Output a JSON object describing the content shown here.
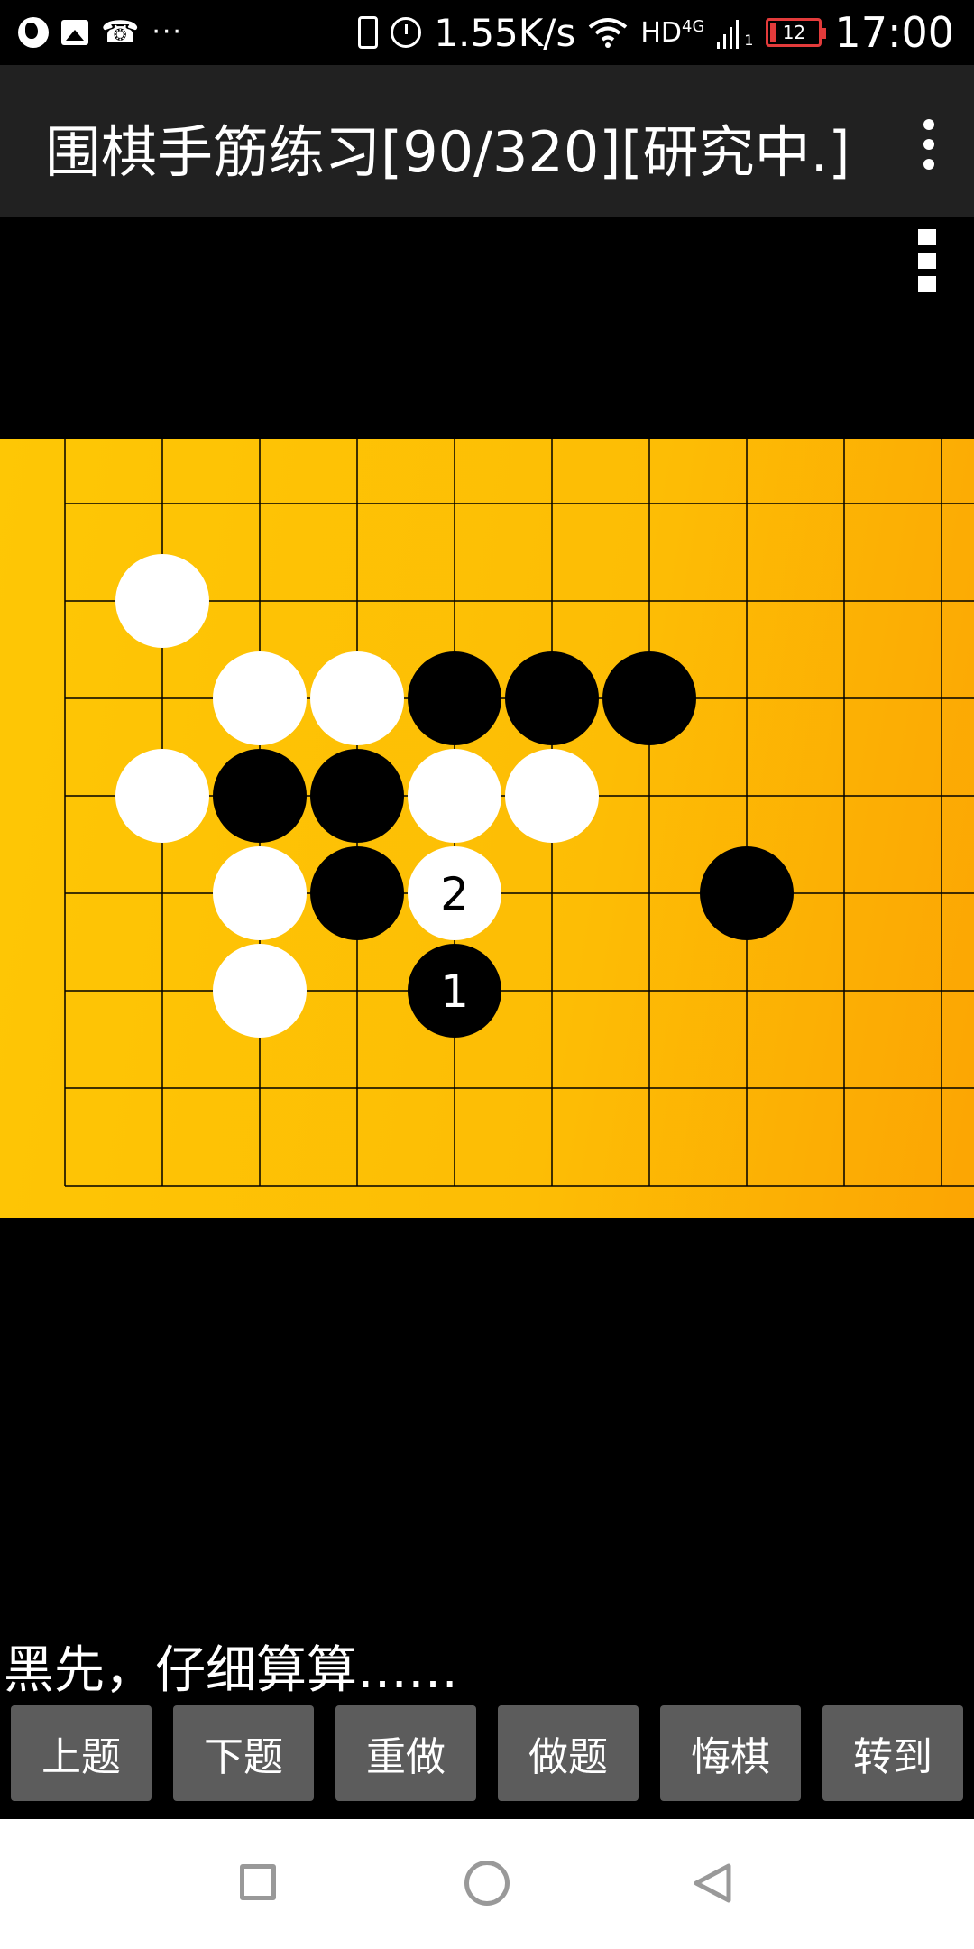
{
  "status_bar": {
    "network_speed": "1.55K/s",
    "network_type": "HD",
    "network_gen": "4G",
    "sim_slot": "1",
    "battery_level": "12",
    "time": "17:00",
    "left_icons": [
      "globe-icon",
      "image-icon",
      "missed-call-icon",
      "more-notifications-icon"
    ],
    "right_icons": [
      "vibrate-icon",
      "alarm-icon",
      "wifi-icon",
      "signal-icon",
      "battery-icon"
    ]
  },
  "app_bar": {
    "title": "围棋手筋练习[90/320][研究中.]",
    "menu_icon": "overflow-menu-icon"
  },
  "board": {
    "menu_icon": "board-menu-icon",
    "background_colors": [
      "#fec705",
      "#fca503"
    ],
    "grid_cols": 10,
    "grid_rows": 7,
    "stones": [
      {
        "color": "white",
        "col": 1,
        "row": 1,
        "label": ""
      },
      {
        "color": "white",
        "col": 2,
        "row": 2,
        "label": ""
      },
      {
        "color": "white",
        "col": 3,
        "row": 2,
        "label": ""
      },
      {
        "color": "black",
        "col": 4,
        "row": 2,
        "label": ""
      },
      {
        "color": "black",
        "col": 5,
        "row": 2,
        "label": ""
      },
      {
        "color": "black",
        "col": 6,
        "row": 2,
        "label": ""
      },
      {
        "color": "white",
        "col": 1,
        "row": 3,
        "label": ""
      },
      {
        "color": "black",
        "col": 2,
        "row": 3,
        "label": ""
      },
      {
        "color": "black",
        "col": 3,
        "row": 3,
        "label": ""
      },
      {
        "color": "white",
        "col": 4,
        "row": 3,
        "label": ""
      },
      {
        "color": "white",
        "col": 5,
        "row": 3,
        "label": ""
      },
      {
        "color": "white",
        "col": 2,
        "row": 4,
        "label": ""
      },
      {
        "color": "black",
        "col": 3,
        "row": 4,
        "label": ""
      },
      {
        "color": "white",
        "col": 4,
        "row": 4,
        "label": "2"
      },
      {
        "color": "black",
        "col": 7,
        "row": 4,
        "label": ""
      },
      {
        "color": "white",
        "col": 2,
        "row": 5,
        "label": ""
      },
      {
        "color": "black",
        "col": 4,
        "row": 5,
        "label": "1"
      }
    ]
  },
  "hint": "黑先，仔细算算……",
  "buttons": [
    {
      "name": "prev-problem-button",
      "label": "上题"
    },
    {
      "name": "next-problem-button",
      "label": "下题"
    },
    {
      "name": "redo-button",
      "label": "重做"
    },
    {
      "name": "solve-button",
      "label": "做题"
    },
    {
      "name": "undo-button",
      "label": "悔棋"
    },
    {
      "name": "goto-button",
      "label": "转到"
    }
  ],
  "nav_bar": {
    "icons": [
      "recent-apps-icon",
      "home-icon",
      "back-icon"
    ]
  }
}
